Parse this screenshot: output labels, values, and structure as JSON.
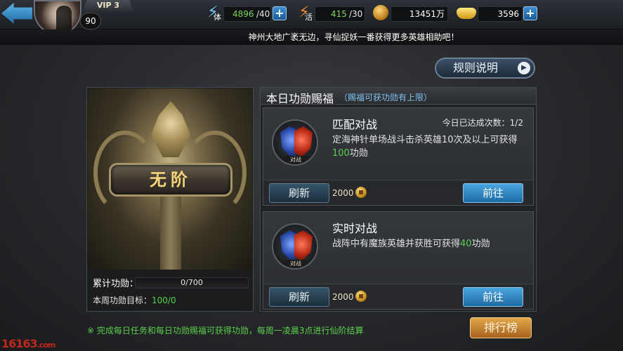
{
  "player": {
    "vip": "VIP 3",
    "level": "90"
  },
  "resources": {
    "stamina": {
      "icon": "lightning-stamina-icon",
      "label": "体",
      "value": "4896",
      "max": "/40"
    },
    "vitality": {
      "icon": "lightning-vitality-icon",
      "label": "活",
      "value": "415",
      "max": "/30"
    },
    "copper": {
      "icon": "copper-coin-icon",
      "value": "13451万"
    },
    "gold": {
      "icon": "gold-ingot-icon",
      "value": "3596"
    }
  },
  "notice": "神州大地广袤无边，寻仙捉妖一番获得更多英雄相助吧！",
  "rules_button": "规则说明",
  "rank": {
    "name": "无阶",
    "progress_label": "累计功勋：",
    "progress_text": "0/700",
    "progress_fraction": 0,
    "weekly_label": "本周功勋目标：",
    "weekly_value": "100/0"
  },
  "daily": {
    "title": "本日功勋赐福",
    "subtitle": "（赐福可获功勋有上限）",
    "cards": [
      {
        "title": "匹配对战",
        "count": "今日已达成次数：1/2",
        "desc_pre": "定海神针单场战斗击杀英雄10次及以上可获得",
        "desc_hl": "100",
        "desc_post": "功勋",
        "emblem_tag": "对战",
        "refresh": "刷新",
        "reward": "2000",
        "goto": "前往"
      },
      {
        "title": "实时对战",
        "count": "",
        "desc_pre": "战阵中有魔族英雄并获胜可获得",
        "desc_hl": "40",
        "desc_post": "功勋",
        "emblem_tag": "对战",
        "refresh": "刷新",
        "reward": "2000",
        "goto": "前往"
      }
    ]
  },
  "tip": "※ 完成每日任务和每日功勋赐福可获得功勋，每周一凌晨3点进行仙阶结算",
  "ranking_button": "排行榜",
  "watermark": {
    "main": "16163",
    "suffix": ".com"
  },
  "colors": {
    "accent_blue": "#1e6aa4",
    "highlight_green": "#56d24a",
    "rank_gold": "#f2d479",
    "progress_orange": "#e3a53a"
  }
}
